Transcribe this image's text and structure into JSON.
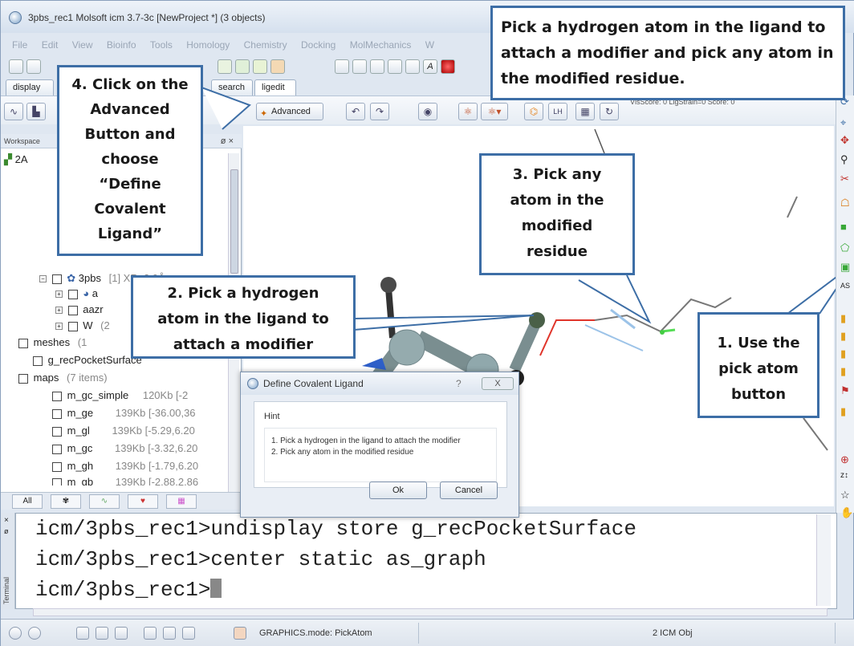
{
  "window": {
    "title": "3pbs_rec1 Molsoft icm 3.7-3c  [NewProject *] (3 objects)"
  },
  "menu": [
    "File",
    "Edit",
    "View",
    "Bioinfo",
    "Tools",
    "Homology",
    "Chemistry",
    "Docking",
    "MolMechanics",
    "W"
  ],
  "tabs": [
    "display",
    "search",
    "ligedit"
  ],
  "toolbar": {
    "advanced_label": "Advanced",
    "score_text": "VlsScore: 0 LigStrain=0 Score: 0"
  },
  "workspace": {
    "header": "Workspace",
    "rows": [
      {
        "label": "2A",
        "meta": ""
      },
      {
        "label": "3pbs",
        "meta": "[1] XR: 2.0Å, per"
      },
      {
        "label": "a",
        "meta": ""
      },
      {
        "label": "aazr",
        "meta": ""
      },
      {
        "label": "W",
        "meta": "(2"
      },
      {
        "label": "meshes",
        "meta": "(1"
      },
      {
        "label": "g_recPocketSurface",
        "meta": ""
      },
      {
        "label": "maps",
        "meta": "(7 items)"
      },
      {
        "label": "m_gc_simple",
        "meta": "120Kb [-2"
      },
      {
        "label": "m_ge",
        "meta": "139Kb [-36.00,36"
      },
      {
        "label": "m_gl",
        "meta": "139Kb [-5.29,6.20"
      },
      {
        "label": "m_gc",
        "meta": "139Kb [-3.32,6.20"
      },
      {
        "label": "m_gh",
        "meta": "139Kb [-1.79,6.20"
      },
      {
        "label": "m_gb",
        "meta": "139Kb [-2.88,2.86"
      }
    ],
    "bottom_tabs": [
      "All"
    ]
  },
  "terminal": {
    "label": "Terminal",
    "lines": [
      "icm/3pbs_rec1>undisplay store g_recPocketSurface",
      "icm/3pbs_rec1>center static as_graph",
      "icm/3pbs_rec1>"
    ]
  },
  "status": {
    "mode": "GRAPHICS.mode: PickAtom",
    "objects": "2 ICM Obj"
  },
  "dialog": {
    "title": "Define Covalent Ligand",
    "help": "?",
    "close": "X",
    "hint_label": "Hint",
    "lines": [
      "1. Pick a hydrogen in the ligand to attach the modifier",
      "2. Pick any atom in the modified residue"
    ],
    "ok": "Ok",
    "cancel": "Cancel"
  },
  "callouts": {
    "top": [
      "Pick a hydrogen atom in the ligand to",
      "attach a modifier and pick any atom in",
      "the modified residue."
    ],
    "step4": [
      "4. Click on the",
      "Advanced",
      "Button and",
      "choose",
      "“Define",
      "Covalent",
      "Ligand”"
    ],
    "step3": [
      "3. Pick any",
      "atom in the",
      "modified",
      "residue"
    ],
    "step2": [
      "2. Pick a hydrogen",
      "atom in the ligand to",
      "attach a modifier"
    ],
    "step1": [
      "1. Use the",
      "pick atom",
      "button"
    ]
  },
  "colors": {
    "callout_border": "#3d6ea6",
    "accent": "#3d6ea6"
  }
}
